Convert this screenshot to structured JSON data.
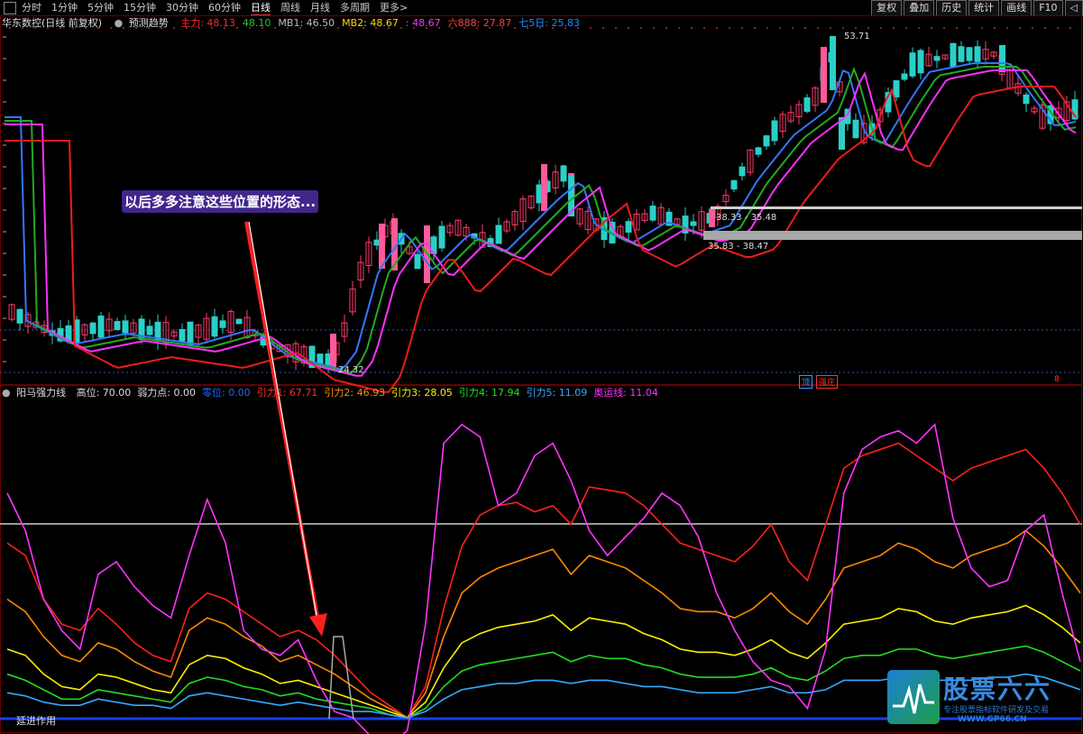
{
  "topbar": {
    "periods": [
      "分时",
      "1分钟",
      "5分钟",
      "15分钟",
      "30分钟",
      "60分钟",
      "日线",
      "周线",
      "月线",
      "多周期",
      "更多>"
    ],
    "active_index": 6,
    "right_buttons": [
      "复权",
      "叠加",
      "历史",
      "统计",
      "画线",
      "F10",
      "◁"
    ]
  },
  "main_chart": {
    "title": "华东数控(日线 前复权)",
    "indicator_name": "预测趋势",
    "ma_labels": [
      {
        "text": "主力: 48.13",
        "color": "#ff2a2a"
      },
      {
        "text": "48.10",
        "color": "#22cc22"
      },
      {
        "text": "MB1: 46.50",
        "color": "#bbbbbb"
      },
      {
        "text": "MB2: 48.67",
        "color": "#ffd700"
      },
      {
        "text": ": 48.67",
        "color": "#ff33ff"
      },
      {
        "text": "六888: 27.87",
        "color": "#ff4040"
      },
      {
        "text": "七5日: 25.83",
        "color": "#2288ff"
      }
    ],
    "high_label": "53.71",
    "low_label": "24.32",
    "zone1_label": "38.33 - 35.48",
    "zone2_label": "35.83 - 38.47",
    "annotation": "以后多多注意这些位置的形态...",
    "badges": [
      {
        "text": "顶",
        "color": "#3399ff"
      },
      {
        "text": "强庄",
        "color": "#ff3333"
      },
      {
        "text": "8",
        "color": "#ff3333"
      }
    ],
    "colors": {
      "up": "#ff3a6a",
      "down": "#2ad0c8",
      "ma_magenta": "#ff30ff",
      "ma_red": "#ee1c1c",
      "ma_green": "#22aa22",
      "ma_blue": "#3377ff"
    }
  },
  "sub_chart": {
    "name": "阳马强力线",
    "params": [
      {
        "text": "高位: 70.00",
        "color": "#dddddd"
      },
      {
        "text": "弱力点: 0.00",
        "color": "#dddddd"
      },
      {
        "text": "零位: 0.00",
        "color": "#2266ff"
      },
      {
        "text": "引力1: 67.71",
        "color": "#ff3030"
      },
      {
        "text": "引力2: 46.93",
        "color": "#ff8c00"
      },
      {
        "text": "引力3: 28.05",
        "color": "#ffee00"
      },
      {
        "text": "引力4: 17.94",
        "color": "#22dd22"
      },
      {
        "text": "引力5: 11.09",
        "color": "#33aaff"
      },
      {
        "text": "奥运线: 11.04",
        "color": "#ff33ff"
      }
    ],
    "bottom_label": "延进作用",
    "chart_data": {
      "type": "line",
      "ylim": [
        0,
        100
      ],
      "x_count": 60,
      "series": [
        {
          "color": "#ff2020",
          "values": [
            56,
            52,
            38,
            30,
            28,
            35,
            30,
            24,
            20,
            18,
            35,
            40,
            38,
            34,
            30,
            26,
            28,
            25,
            20,
            14,
            8,
            4,
            0,
            10,
            35,
            55,
            65,
            68,
            69,
            66,
            68,
            62,
            74,
            73,
            72,
            68,
            62,
            56,
            54,
            52,
            50,
            55,
            62,
            50,
            44,
            62,
            80,
            84,
            86,
            88,
            84,
            80,
            76,
            80,
            82,
            84,
            86,
            80,
            72,
            62
          ]
        },
        {
          "color": "#ff8800",
          "values": [
            38,
            34,
            26,
            20,
            18,
            24,
            22,
            18,
            15,
            13,
            28,
            32,
            30,
            26,
            23,
            18,
            20,
            17,
            14,
            10,
            6,
            3,
            0,
            8,
            26,
            40,
            45,
            48,
            50,
            52,
            54,
            46,
            52,
            50,
            48,
            44,
            40,
            35,
            34,
            34,
            32,
            35,
            40,
            34,
            30,
            38,
            48,
            50,
            52,
            56,
            54,
            50,
            48,
            52,
            54,
            56,
            60,
            55,
            48,
            40
          ]
        },
        {
          "color": "#ffee00",
          "values": [
            22,
            20,
            14,
            10,
            9,
            14,
            13,
            11,
            9,
            8,
            17,
            20,
            19,
            16,
            14,
            11,
            12,
            10,
            8,
            6,
            4,
            2,
            0,
            5,
            16,
            24,
            27,
            29,
            30,
            31,
            33,
            28,
            32,
            31,
            30,
            27,
            25,
            22,
            21,
            21,
            20,
            22,
            25,
            21,
            19,
            24,
            30,
            31,
            32,
            35,
            34,
            31,
            30,
            32,
            33,
            34,
            36,
            33,
            29,
            24
          ]
        },
        {
          "color": "#22dd22",
          "values": [
            14,
            12,
            9,
            6,
            6,
            9,
            8,
            7,
            6,
            5,
            11,
            13,
            12,
            10,
            9,
            7,
            8,
            6,
            5,
            4,
            3,
            1,
            0,
            3,
            10,
            15,
            17,
            18,
            19,
            20,
            21,
            18,
            20,
            19,
            19,
            17,
            16,
            14,
            13,
            13,
            13,
            14,
            16,
            13,
            12,
            15,
            19,
            20,
            20,
            22,
            22,
            20,
            19,
            20,
            21,
            22,
            23,
            21,
            18,
            15
          ]
        },
        {
          "color": "#33aaff",
          "values": [
            8,
            7,
            5,
            4,
            4,
            6,
            5,
            4,
            4,
            3,
            7,
            8,
            7,
            6,
            5,
            4,
            5,
            4,
            3,
            2,
            2,
            1,
            0,
            2,
            6,
            9,
            10,
            11,
            11,
            12,
            12,
            11,
            12,
            12,
            11,
            10,
            10,
            9,
            8,
            8,
            8,
            9,
            10,
            8,
            8,
            9,
            12,
            12,
            12,
            13,
            13,
            12,
            12,
            12,
            13,
            13,
            14,
            13,
            11,
            9
          ]
        },
        {
          "color": "#ff33ff",
          "values": [
            72,
            60,
            38,
            28,
            22,
            46,
            50,
            42,
            36,
            32,
            52,
            70,
            56,
            28,
            22,
            20,
            25,
            12,
            2,
            0,
            -6,
            -10,
            -4,
            30,
            88,
            94,
            90,
            68,
            72,
            84,
            88,
            76,
            60,
            52,
            58,
            64,
            72,
            68,
            58,
            40,
            28,
            18,
            12,
            10,
            3,
            22,
            72,
            86,
            90,
            92,
            88,
            94,
            64,
            48,
            42,
            44,
            60,
            65,
            40,
            18
          ]
        }
      ]
    }
  },
  "logo": {
    "title": "股票六六",
    "slogan": "专注股票指标软件研发及交易",
    "url": "WWW.GP66.CN"
  }
}
